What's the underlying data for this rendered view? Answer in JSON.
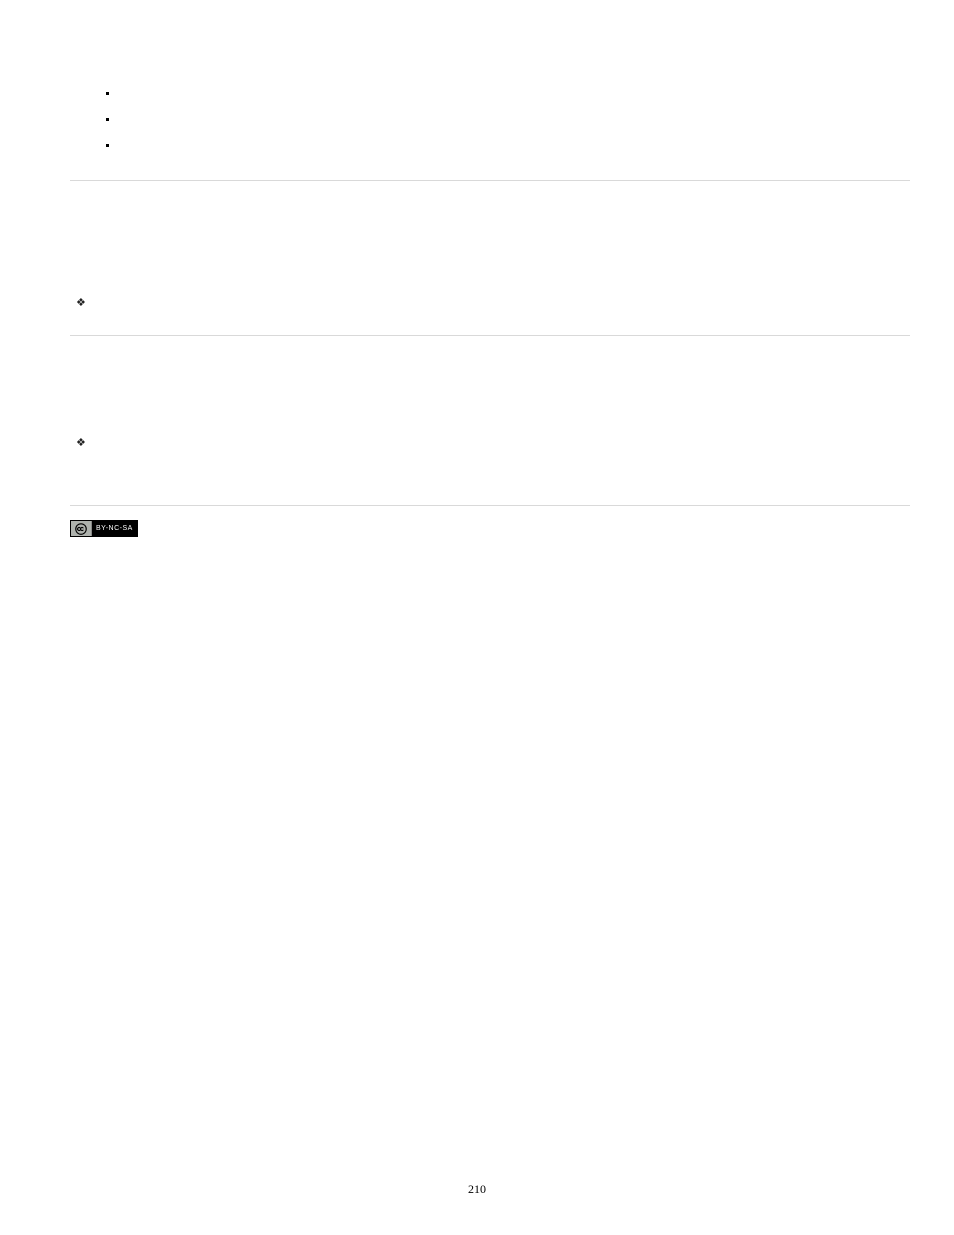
{
  "page_number": "210",
  "cc_badge_text": "BY-NC-SA"
}
